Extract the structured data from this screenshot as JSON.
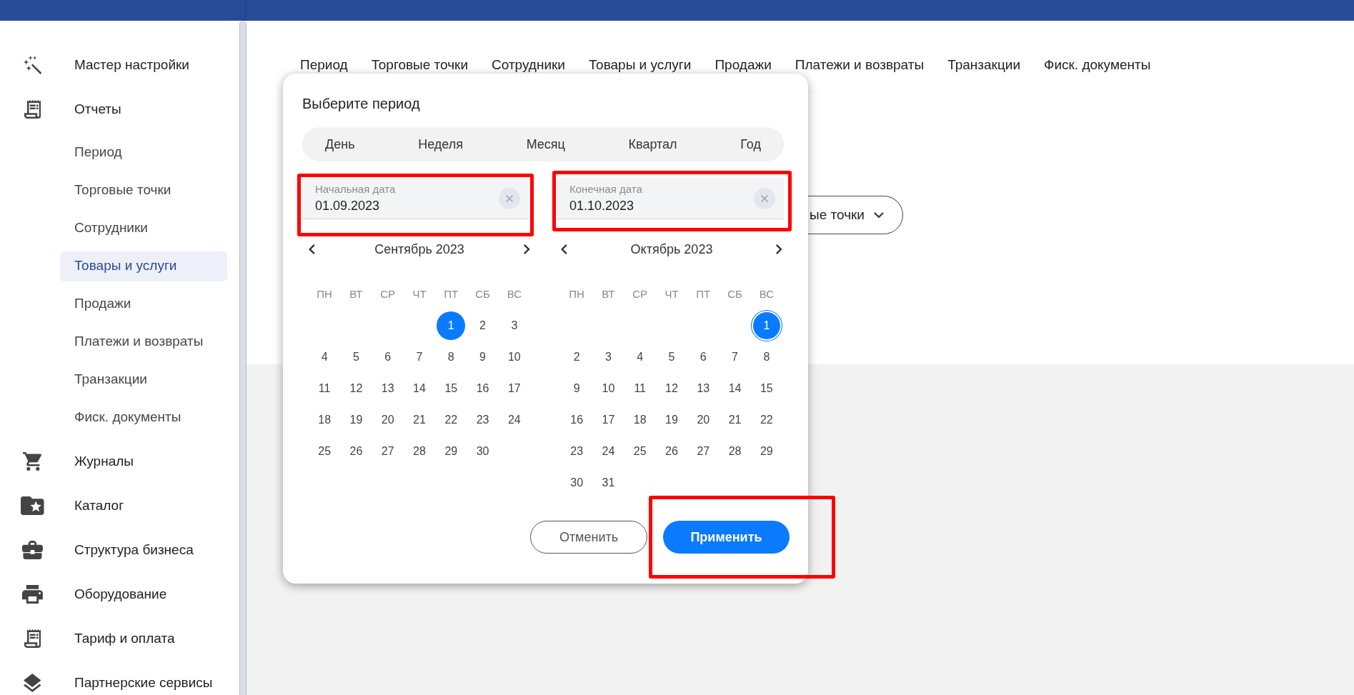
{
  "sidebar": {
    "items": [
      {
        "label": "Мастер настройки",
        "selected": false
      },
      {
        "label": "Отчеты",
        "selected": false,
        "children": [
          {
            "label": "Период",
            "selected": false
          },
          {
            "label": "Торговые точки",
            "selected": false
          },
          {
            "label": "Сотрудники",
            "selected": false
          },
          {
            "label": "Товары и услуги",
            "selected": true
          },
          {
            "label": "Продажи",
            "selected": false
          },
          {
            "label": "Платежи и возвраты",
            "selected": false
          },
          {
            "label": "Транзакции",
            "selected": false
          },
          {
            "label": "Фиск. документы",
            "selected": false
          }
        ]
      },
      {
        "label": "Журналы",
        "selected": false
      },
      {
        "label": "Каталог",
        "selected": false
      },
      {
        "label": "Структура бизнеса",
        "selected": false
      },
      {
        "label": "Оборудование",
        "selected": false
      },
      {
        "label": "Тариф и оплата",
        "selected": false
      },
      {
        "label": "Партнерские сервисы",
        "selected": false
      }
    ]
  },
  "nav_tabs": [
    {
      "label": "Период",
      "selected": false
    },
    {
      "label": "Торговые точки",
      "selected": false
    },
    {
      "label": "Сотрудники",
      "selected": false
    },
    {
      "label": "Товары и услуги",
      "selected": false
    },
    {
      "label": "Продажи",
      "selected": false
    },
    {
      "label": "Платежи и возвраты",
      "selected": false
    },
    {
      "label": "Транзакции",
      "selected": false
    },
    {
      "label": "Фиск. документы",
      "selected": false
    }
  ],
  "filter_button": {
    "label": "ые точки"
  },
  "period_dialog": {
    "title": "Выберите период",
    "presets": [
      {
        "label": "День",
        "selected": false
      },
      {
        "label": "Неделя",
        "selected": false
      },
      {
        "label": "Месяц",
        "selected": false
      },
      {
        "label": "Квартал",
        "selected": false
      },
      {
        "label": "Год",
        "selected": false
      }
    ],
    "start_date": {
      "label": "Начальная дата",
      "value": "01.09.2023",
      "highlighted": true
    },
    "end_date": {
      "label": "Конечная дата",
      "value": "01.10.2023",
      "highlighted": true
    },
    "calendars": [
      {
        "month": "Сентябрь 2023",
        "weekdays": [
          "ПН",
          "ВТ",
          "СР",
          "ЧТ",
          "ПТ",
          "СБ",
          "ВС"
        ],
        "weeks": [
          [
            {
              "label": "1",
              "selected": true,
              "focused": false
            },
            {
              "label": "2",
              "selected": false,
              "focused": false
            },
            {
              "label": "3",
              "selected": false,
              "focused": false
            }
          ],
          [
            {
              "label": "4",
              "selected": false,
              "focused": false
            },
            {
              "label": "5",
              "selected": false,
              "focused": false
            },
            {
              "label": "6",
              "selected": false,
              "focused": false
            },
            {
              "label": "7",
              "selected": false,
              "focused": false
            },
            {
              "label": "8",
              "selected": false,
              "focused": false
            },
            {
              "label": "9",
              "selected": false,
              "focused": false
            },
            {
              "label": "10",
              "selected": false,
              "focused": false
            }
          ],
          [
            {
              "label": "11",
              "selected": false,
              "focused": false
            },
            {
              "label": "12",
              "selected": false,
              "focused": false
            },
            {
              "label": "13",
              "selected": false,
              "focused": false
            },
            {
              "label": "14",
              "selected": false,
              "focused": false
            },
            {
              "label": "15",
              "selected": false,
              "focused": false
            },
            {
              "label": "16",
              "selected": false,
              "focused": false
            },
            {
              "label": "17",
              "selected": false,
              "focused": false
            }
          ],
          [
            {
              "label": "18",
              "selected": false,
              "focused": false
            },
            {
              "label": "19",
              "selected": false,
              "focused": false
            },
            {
              "label": "20",
              "selected": false,
              "focused": false
            },
            {
              "label": "21",
              "selected": false,
              "focused": false
            },
            {
              "label": "22",
              "selected": false,
              "focused": false
            },
            {
              "label": "23",
              "selected": false,
              "focused": false
            },
            {
              "label": "24",
              "selected": false,
              "focused": false
            }
          ],
          [
            {
              "label": "25",
              "selected": false,
              "focused": false
            },
            {
              "label": "26",
              "selected": false,
              "focused": false
            },
            {
              "label": "27",
              "selected": false,
              "focused": false
            },
            {
              "label": "28",
              "selected": false,
              "focused": false
            },
            {
              "label": "29",
              "selected": false,
              "focused": false
            },
            {
              "label": "30",
              "selected": false,
              "focused": false
            }
          ]
        ]
      },
      {
        "month": "Октябрь 2023",
        "weekdays": [
          "ПН",
          "ВТ",
          "СР",
          "ЧТ",
          "ПТ",
          "СБ",
          "ВС"
        ],
        "weeks": [
          [
            {
              "label": "1",
              "selected": true,
              "focused": true
            }
          ],
          [
            {
              "label": "2",
              "selected": false,
              "focused": false
            },
            {
              "label": "3",
              "selected": false,
              "focused": false
            },
            {
              "label": "4",
              "selected": false,
              "focused": false
            },
            {
              "label": "5",
              "selected": false,
              "focused": false
            },
            {
              "label": "6",
              "selected": false,
              "focused": false
            },
            {
              "label": "7",
              "selected": false,
              "focused": false
            },
            {
              "label": "8",
              "selected": false,
              "focused": false
            }
          ],
          [
            {
              "label": "9",
              "selected": false,
              "focused": false
            },
            {
              "label": "10",
              "selected": false,
              "focused": false
            },
            {
              "label": "11",
              "selected": false,
              "focused": false
            },
            {
              "label": "12",
              "selected": false,
              "focused": false
            },
            {
              "label": "13",
              "selected": false,
              "focused": false
            },
            {
              "label": "14",
              "selected": false,
              "focused": false
            },
            {
              "label": "15",
              "selected": false,
              "focused": false
            }
          ],
          [
            {
              "label": "16",
              "selected": false,
              "focused": false
            },
            {
              "label": "17",
              "selected": false,
              "focused": false
            },
            {
              "label": "18",
              "selected": false,
              "focused": false
            },
            {
              "label": "19",
              "selected": false,
              "focused": false
            },
            {
              "label": "20",
              "selected": false,
              "focused": false
            },
            {
              "label": "21",
              "selected": false,
              "focused": false
            },
            {
              "label": "22",
              "selected": false,
              "focused": false
            }
          ],
          [
            {
              "label": "23",
              "selected": false,
              "focused": false
            },
            {
              "label": "24",
              "selected": false,
              "focused": false
            },
            {
              "label": "25",
              "selected": false,
              "focused": false
            },
            {
              "label": "26",
              "selected": false,
              "focused": false
            },
            {
              "label": "27",
              "selected": false,
              "focused": false
            },
            {
              "label": "28",
              "selected": false,
              "focused": false
            },
            {
              "label": "29",
              "selected": false,
              "focused": false
            }
          ],
          [
            {
              "label": "30",
              "selected": false,
              "focused": false
            },
            {
              "label": "31",
              "selected": false,
              "focused": false
            }
          ]
        ]
      }
    ],
    "buttons": [
      {
        "label": "Отменить",
        "kind": "secondary",
        "highlighted": false
      },
      {
        "label": "Применить",
        "kind": "primary",
        "highlighted": true
      }
    ]
  }
}
